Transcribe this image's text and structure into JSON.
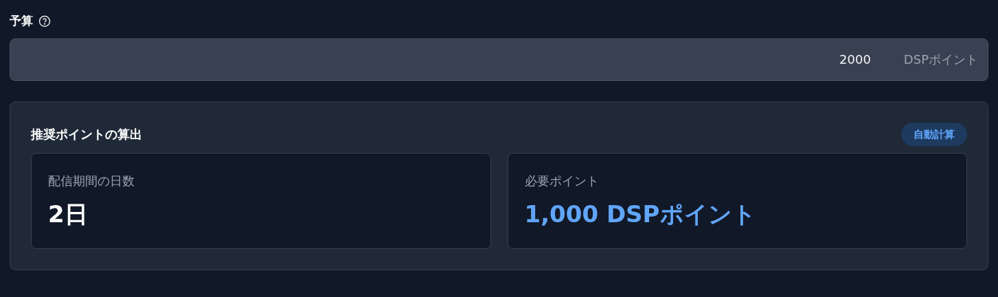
{
  "budget": {
    "label": "予算",
    "value": "2000",
    "unit": "DSPポイント"
  },
  "recommendation": {
    "title": "推奨ポイントの算出",
    "badge": "自動計算",
    "stats": [
      {
        "label": "配信期間の日数",
        "value": "2日",
        "highlight": false
      },
      {
        "label": "必要ポイント",
        "value": "1,000 DSPポイント",
        "highlight": true
      }
    ]
  }
}
